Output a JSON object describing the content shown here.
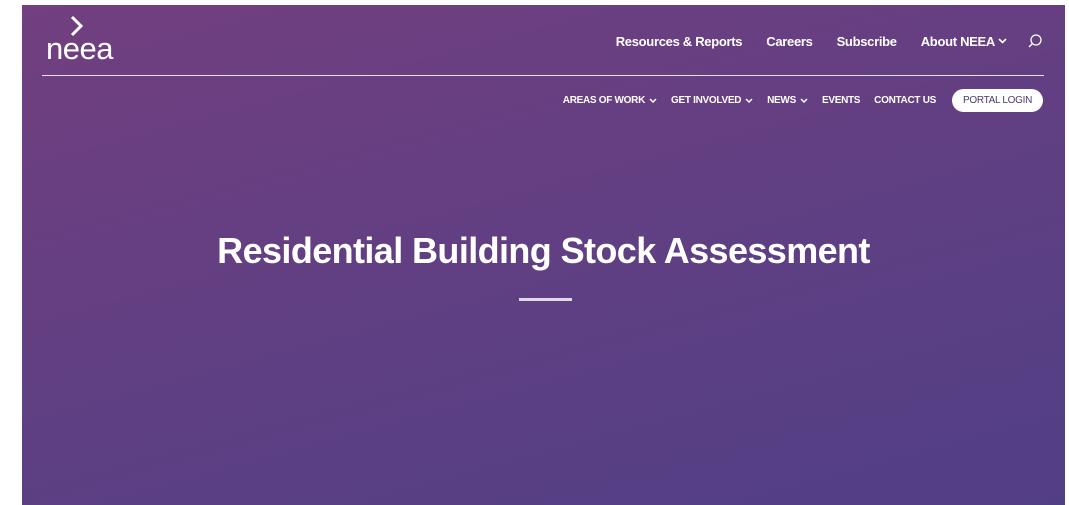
{
  "brand": {
    "logo_text": "neea"
  },
  "top_nav": {
    "items": [
      {
        "label": "Resources & Reports"
      },
      {
        "label": "Careers"
      },
      {
        "label": "Subscribe"
      },
      {
        "label": "About NEEA"
      }
    ],
    "search_icon": "search-icon"
  },
  "sub_nav": {
    "items": [
      {
        "label": "AREAS OF WORK"
      },
      {
        "label": "GET INVOLVED"
      },
      {
        "label": "NEWS"
      },
      {
        "label": "EVENTS"
      },
      {
        "label": "CONTACT US"
      }
    ],
    "portal_button": "PORTAL LOGIN"
  },
  "hero": {
    "title": "Residential Building Stock Assessment"
  },
  "colors": {
    "hero_top": "#723f80",
    "hero_bottom": "#513f86",
    "text": "#ffffff",
    "button_text": "#4a3a6e"
  }
}
